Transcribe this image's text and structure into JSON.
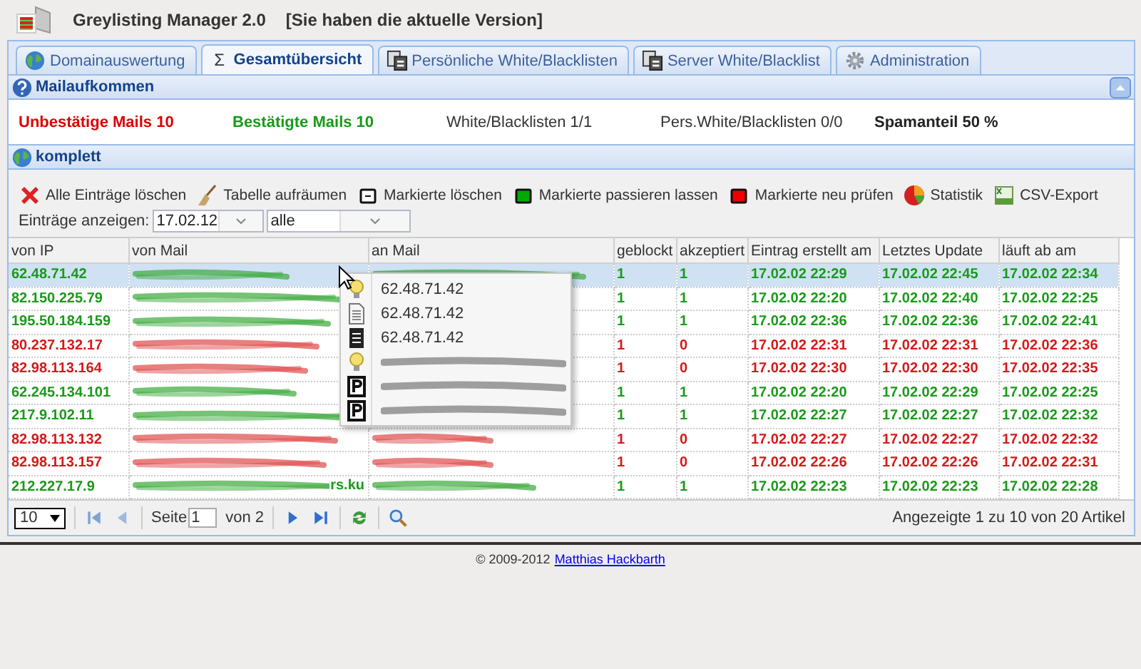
{
  "app": {
    "title": "Greylisting Manager 2.0",
    "version_note": "[Sie haben die aktuelle Version]"
  },
  "tabs": [
    {
      "label": "Domainauswertung",
      "kind": "globe",
      "selected": false
    },
    {
      "label": "Gesamtübersicht",
      "icon_text": "Σ",
      "selected": true
    },
    {
      "label": "Persönliche White/Blacklisten",
      "kind": "docs",
      "selected": false
    },
    {
      "label": "Server White/Blacklist",
      "kind": "docs",
      "selected": false
    },
    {
      "label": "Administration",
      "kind": "gear",
      "selected": false
    }
  ],
  "mail_section": {
    "title": "Mailaufkommen",
    "expanded": true
  },
  "stats": [
    {
      "text": "Unbestätige Mails 10",
      "kind": "bad"
    },
    {
      "text": "Bestätigte Mails 10",
      "kind": "good"
    },
    {
      "text": "White/Blacklisten 1/1",
      "kind": "plain"
    },
    {
      "text": "Pers.White/Blacklisten 0/0",
      "kind": "plain"
    },
    {
      "text": "Spamanteil 50 %",
      "kind": "strong"
    }
  ],
  "list_section": {
    "title": "komplett"
  },
  "actions": [
    {
      "label": "Alle Einträge löschen",
      "kind": "cross"
    },
    {
      "label": "Tabelle aufräumen",
      "kind": "broom"
    },
    {
      "label": "Markierte löschen",
      "kind": "square-white"
    },
    {
      "label": "Markierte passieren lassen",
      "kind": "square-green"
    },
    {
      "label": "Markierte neu prüfen",
      "kind": "square-red"
    },
    {
      "label": "Statistik",
      "kind": "pie"
    },
    {
      "label": "CSV-Export",
      "kind": "sheet"
    }
  ],
  "filter": {
    "label": "Einträge anzeigen:",
    "date": "17.02.12",
    "scope": "alle"
  },
  "columns": [
    "von IP",
    "von Mail",
    "an Mail",
    "geblockt",
    "akzeptiert",
    "Eintrag erstellt am",
    "Letztes Update",
    "läuft ab am"
  ],
  "rows": [
    {
      "ip": "62.48.71.42",
      "kind": "passed",
      "selected": true,
      "to_redacted": true,
      "geblockt": "1",
      "akzeptiert": "1",
      "created": "17.02.02 22:29",
      "updated": "17.02.02 22:45",
      "expires": "17.02.02 22:34"
    },
    {
      "ip": "82.150.225.79",
      "kind": "passed",
      "selected": false,
      "to_redacted": false,
      "geblockt": "1",
      "akzeptiert": "1",
      "created": "17.02.02 22:20",
      "updated": "17.02.02 22:40",
      "expires": "17.02.02 22:25"
    },
    {
      "ip": "195.50.184.159",
      "kind": "passed",
      "selected": false,
      "to_redacted": false,
      "geblockt": "1",
      "akzeptiert": "1",
      "created": "17.02.02 22:36",
      "updated": "17.02.02 22:36",
      "expires": "17.02.02 22:41"
    },
    {
      "ip": "80.237.132.17",
      "kind": "blocked",
      "selected": false,
      "to_redacted": false,
      "geblockt": "1",
      "akzeptiert": "0",
      "created": "17.02.02 22:31",
      "updated": "17.02.02 22:31",
      "expires": "17.02.02 22:36"
    },
    {
      "ip": "82.98.113.164",
      "kind": "blocked",
      "selected": false,
      "to_redacted": false,
      "geblockt": "1",
      "akzeptiert": "0",
      "created": "17.02.02 22:30",
      "updated": "17.02.02 22:30",
      "expires": "17.02.02 22:35"
    },
    {
      "ip": "62.245.134.101",
      "kind": "passed",
      "selected": false,
      "to_redacted": false,
      "geblockt": "1",
      "akzeptiert": "1",
      "created": "17.02.02 22:20",
      "updated": "17.02.02 22:29",
      "expires": "17.02.02 22:25"
    },
    {
      "ip": "217.9.102.11",
      "kind": "passed",
      "selected": false,
      "to_redacted": false,
      "geblockt": "1",
      "akzeptiert": "1",
      "created": "17.02.02 22:27",
      "updated": "17.02.02 22:27",
      "expires": "17.02.02 22:32"
    },
    {
      "ip": "82.98.113.132",
      "kind": "blocked",
      "selected": false,
      "to_redacted": true,
      "geblockt": "1",
      "akzeptiert": "0",
      "created": "17.02.02 22:27",
      "updated": "17.02.02 22:27",
      "expires": "17.02.02 22:32"
    },
    {
      "ip": "82.98.113.157",
      "kind": "blocked",
      "selected": false,
      "to_redacted": true,
      "geblockt": "1",
      "akzeptiert": "0",
      "created": "17.02.02 22:26",
      "updated": "17.02.02 22:26",
      "expires": "17.02.02 22:31"
    },
    {
      "ip": "212.227.17.9",
      "kind": "passed",
      "selected": false,
      "to_redacted": true,
      "from_fragment": "rs.ku",
      "geblockt": "1",
      "akzeptiert": "1",
      "created": "17.02.02 22:23",
      "updated": "17.02.02 22:23",
      "expires": "17.02.02 22:28"
    }
  ],
  "context_menu": [
    {
      "kind": "bulb",
      "text": "62.48.71.42",
      "redacted": false
    },
    {
      "kind": "doc",
      "text": "62.48.71.42",
      "redacted": false
    },
    {
      "kind": "doc-dark",
      "text": "62.48.71.42",
      "redacted": false
    },
    {
      "kind": "bulb",
      "redacted": true
    },
    {
      "kind": "p",
      "redacted": true
    },
    {
      "kind": "p",
      "redacted": true
    }
  ],
  "pager": {
    "page_size": "10",
    "page_label": "Seite",
    "page": "1",
    "page_total": "von 2",
    "info": "Angezeigte 1 zu 10 von 20 Artikel"
  },
  "footer": {
    "copyright": "© 2009-2012",
    "author_link": "Matthias Hackbarth"
  }
}
